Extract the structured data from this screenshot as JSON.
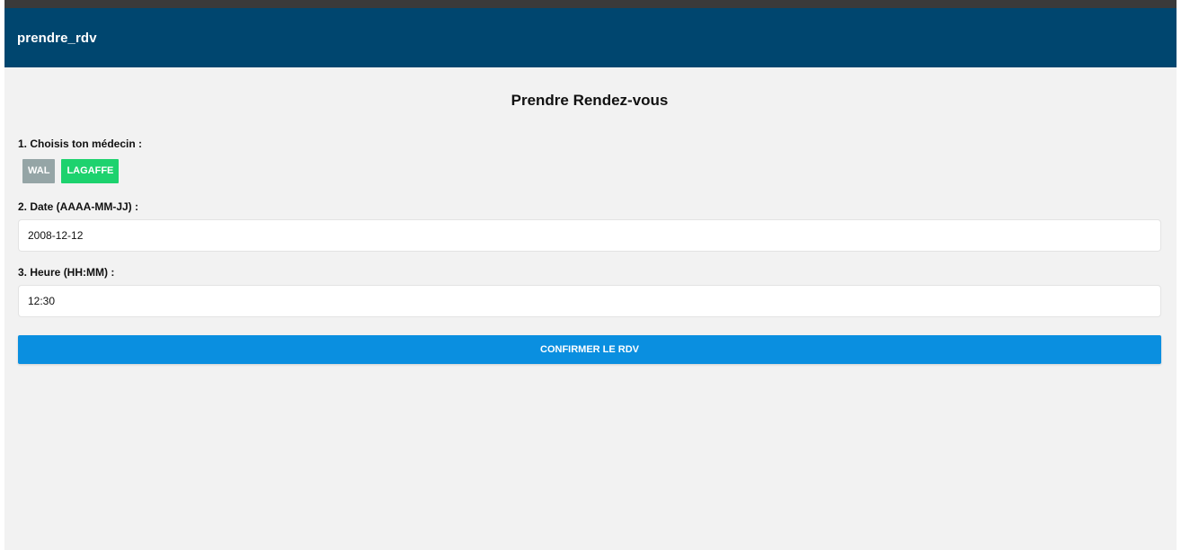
{
  "header": {
    "title": "prendre_rdv"
  },
  "page": {
    "title": "Prendre Rendez-vous"
  },
  "doctor": {
    "label": "1. Choisis ton médecin :",
    "options": [
      {
        "label": "WAL",
        "selected": false
      },
      {
        "label": "LAGAFFE",
        "selected": true
      }
    ]
  },
  "date": {
    "label": "2. Date (AAAA-MM-JJ) :",
    "value": "2008-12-12"
  },
  "time": {
    "label": "3. Heure (HH:MM) :",
    "value": "12:30"
  },
  "confirm": {
    "label": "CONFIRMER LE RDV"
  },
  "colors": {
    "header_bg": "#00466f",
    "selected_doctor": "#1dd26e",
    "unselected_doctor": "#95a5a6",
    "confirm_button": "#0a8fe0",
    "page_bg": "#f2f2f2"
  }
}
